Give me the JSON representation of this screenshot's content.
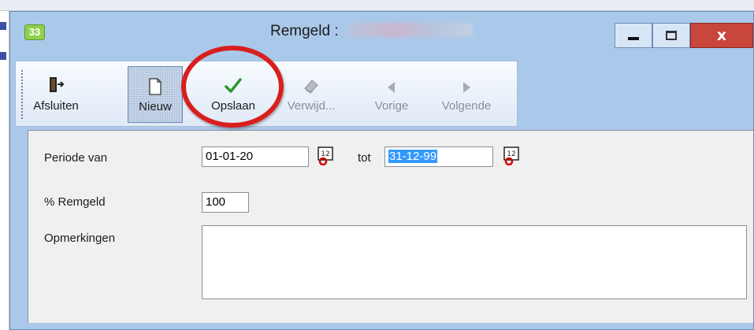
{
  "window": {
    "title": "Remgeld :",
    "app_icon_text": "33"
  },
  "toolbar": {
    "buttons": [
      {
        "label": "Afsluiten",
        "icon": "exit-door-icon",
        "state": "enabled"
      },
      {
        "label": "Nieuw",
        "icon": "new-document-icon",
        "state": "pressed"
      },
      {
        "label": "Opslaan",
        "icon": "checkmark-icon",
        "state": "enabled"
      },
      {
        "label": "Verwijd...",
        "icon": "eraser-icon",
        "state": "disabled"
      },
      {
        "label": "Vorige",
        "icon": "arrow-left-icon",
        "state": "disabled"
      },
      {
        "label": "Volgende",
        "icon": "arrow-right-icon",
        "state": "disabled"
      }
    ]
  },
  "form": {
    "periode_label": "Periode van",
    "periode_van": "01-01-20",
    "tot_label": "tot",
    "periode_tot": "31-12-99",
    "remgeld_label": "% Remgeld",
    "remgeld_value": "100",
    "opmerkingen_label": "Opmerkingen",
    "opmerkingen_value": ""
  },
  "colors": {
    "titlebar": "#aac9ea",
    "close_button": "#c9463d",
    "highlight_circle": "#d91e1e",
    "selection": "#3399ff"
  }
}
